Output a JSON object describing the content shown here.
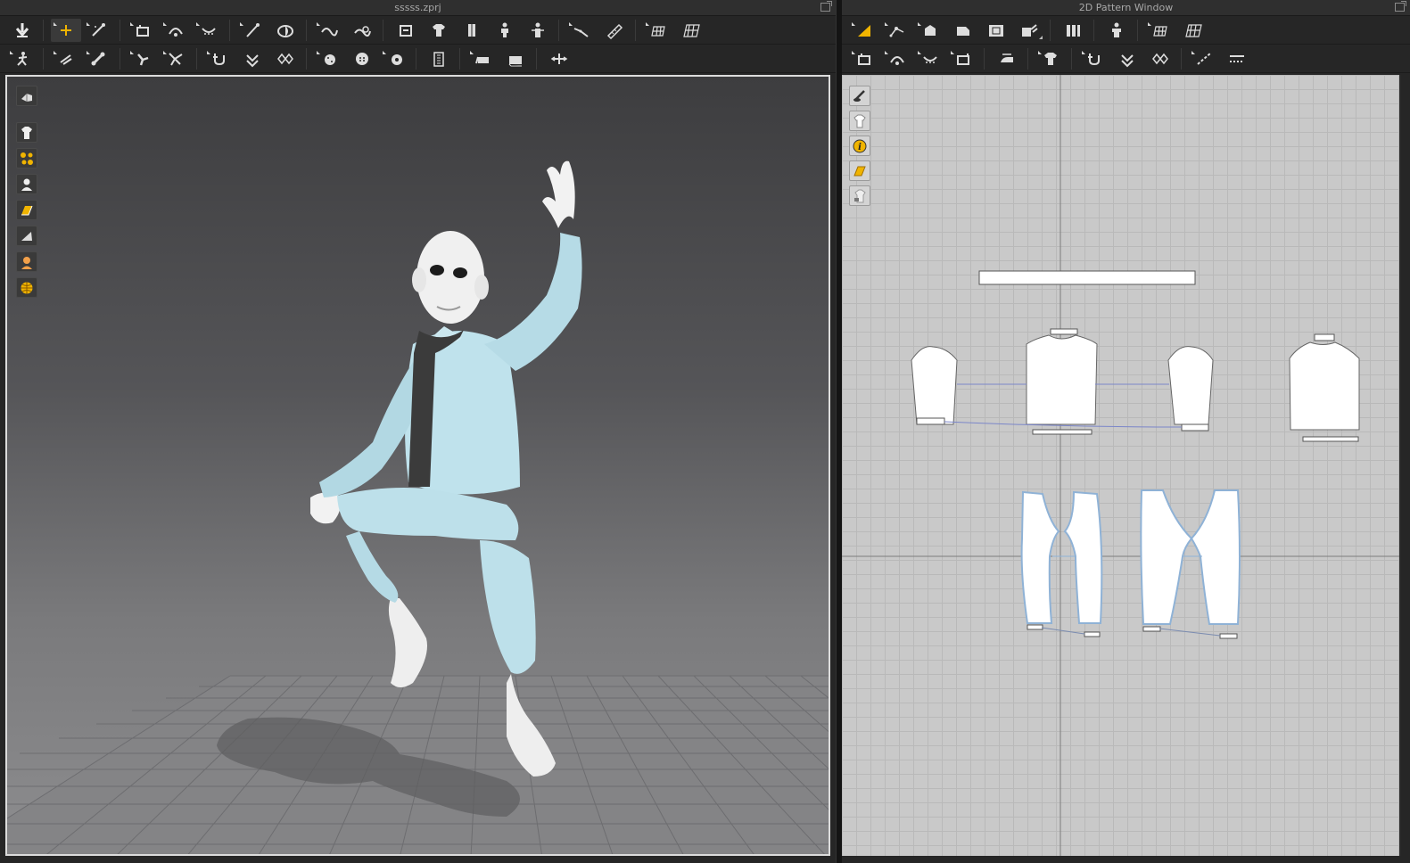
{
  "left_panel": {
    "title": "sssss.zprj"
  },
  "right_panel": {
    "title": "2D Pattern Window"
  },
  "toolbar3d_row1": [
    "drop-avatar-icon",
    "select-move-icon",
    "edit-pattern-3d-icon",
    "tack-icon",
    "tack-on-avatar-icon",
    "tack-two-icon",
    "pin-icon",
    "fold-icon",
    "brush-icon",
    "sculpt-icon",
    "flatten-icon",
    "garment-front-icon",
    "garment-side-icon",
    "avatar-front-icon",
    "avatar-back-icon",
    "measure-icon",
    "tape-icon",
    "grid-icon",
    "grid-2-icon"
  ],
  "toolbar3d_row2": [
    "pose-icon",
    "move-pin-icon",
    "bone-icon",
    "bone-edit-icon",
    "seam-icon",
    "puckering-icon",
    "button-add-icon",
    "button-select-icon",
    "button-lock-icon",
    "zipper-icon",
    "trim-icon",
    "trim-2-icon",
    "transform-icon"
  ],
  "toolbar2d_row1": [
    "transform-pattern-icon",
    "edit-point-icon",
    "polygon-icon",
    "rectangle-icon",
    "internal-shape-icon",
    "fold-arrange-icon",
    "pleat-icon",
    "avatar-arrange-icon",
    "grid-icon",
    "grid-2-icon"
  ],
  "toolbar2d_row2": [
    "segment-sewing-icon",
    "free-sewing-icon",
    "m-n-sewing-icon",
    "check-sewing-icon",
    "steam-icon",
    "topstitch-icon",
    "elastic-icon",
    "puckering-icon",
    "smocking-icon",
    "line-icon",
    "dashed-line-icon"
  ],
  "viewport3d_tools": [
    "view-mode-icon",
    "garment-toggle-icon",
    "particle-icon",
    "avatar-toggle-icon",
    "texture-icon",
    "surface-icon",
    "skin-icon",
    "environment-icon"
  ],
  "viewport2d_tools": [
    "show-pattern-icon",
    "show-garment-icon",
    "info-icon",
    "texture-icon",
    "lock-icon"
  ],
  "colors": {
    "garment": "#bfe2ec",
    "avatar": "#f2f2f2",
    "scarf": "#3b3b3b",
    "pattern_fill": "#ffffff",
    "pattern_outline": "#8fb2d6",
    "sewing_line": "#7b86c9",
    "accent": "#f0b400"
  }
}
